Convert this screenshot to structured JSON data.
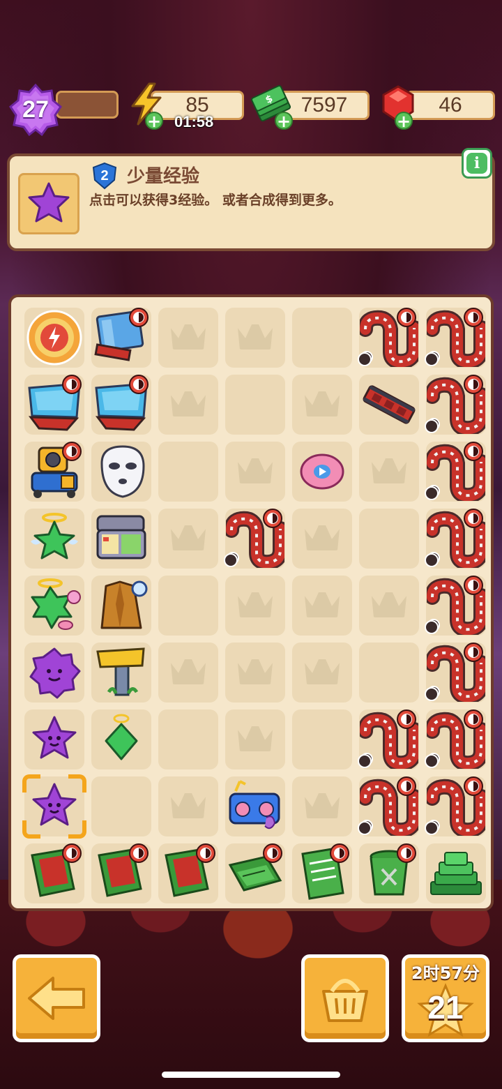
{
  "player": {
    "level": "27"
  },
  "resources": {
    "energy": {
      "value": "85",
      "timer": "01:58",
      "icon": "lightning-icon"
    },
    "cash": {
      "value": "7597",
      "icon": "cash-stack-icon"
    },
    "gems": {
      "value": "46",
      "icon": "ruby-icon"
    }
  },
  "info": {
    "item_level": "2",
    "title": "少量经验",
    "description": "点击可以获得3经验。 或者合成得到更多。",
    "info_button": "i"
  },
  "board": {
    "rows": [
      [
        "energy-orb",
        "film-screen",
        "crown",
        "crown",
        "empty",
        "film-reel",
        "film-reel"
      ],
      [
        "movie-screen",
        "movie-screen",
        "crown",
        "empty",
        "crown",
        "film-strip",
        "film-reel"
      ],
      [
        "robot-camera",
        "ghost-mask",
        "empty",
        "crown",
        "vinyl-disc",
        "crown",
        "film-reel"
      ],
      [
        "green-star-halo",
        "lunch-box",
        "crown",
        "film-reel",
        "crown",
        "empty",
        "film-reel"
      ],
      [
        "green-star-bubble",
        "trench-coat",
        "empty",
        "crown",
        "crown",
        "crown",
        "film-reel"
      ],
      [
        "purple-blob",
        "signpost",
        "crown",
        "crown",
        "crown",
        "empty",
        "film-reel"
      ],
      [
        "purple-star",
        "green-gem-halo",
        "empty",
        "crown",
        "empty",
        "film-reel",
        "film-reel"
      ],
      [
        "purple-star-selected",
        "empty",
        "crown",
        "boombox",
        "crown",
        "film-reel",
        "film-reel"
      ],
      [
        "red-book",
        "red-book",
        "red-book",
        "script-pages",
        "script-sheet",
        "trash-can",
        "cash-pile"
      ]
    ],
    "locked": [
      [
        0,
        1
      ],
      [
        0,
        5
      ],
      [
        0,
        6
      ],
      [
        1,
        0
      ],
      [
        1,
        1
      ],
      [
        1,
        6
      ],
      [
        2,
        0
      ],
      [
        2,
        6
      ],
      [
        3,
        3
      ],
      [
        3,
        6
      ],
      [
        4,
        6
      ],
      [
        5,
        6
      ],
      [
        6,
        5
      ],
      [
        6,
        6
      ],
      [
        7,
        5
      ],
      [
        7,
        6
      ],
      [
        8,
        0
      ],
      [
        8,
        1
      ],
      [
        8,
        2
      ],
      [
        8,
        3
      ],
      [
        8,
        4
      ],
      [
        8,
        5
      ]
    ]
  },
  "bottom": {
    "order_timer": "2时57分",
    "order_count": "21"
  },
  "colors": {
    "panel": "#f5e3be",
    "border": "#7a4a34",
    "button": "#f6b23a",
    "accent_purple": "#a044d6",
    "film_red": "#c8322a"
  }
}
